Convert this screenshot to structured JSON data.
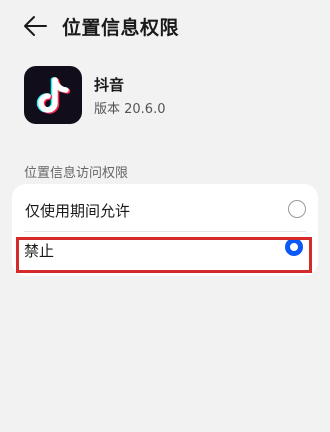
{
  "header": {
    "back_icon": "arrow-left-icon",
    "title": "位置信息权限"
  },
  "app": {
    "icon": "tiktok-logo-icon",
    "name": "抖音",
    "version": "版本 20.6.0"
  },
  "permission": {
    "section_label": "位置信息访问权限",
    "options": [
      {
        "label": "仅使用期间允许",
        "selected": false
      },
      {
        "label": "禁止",
        "selected": true
      }
    ]
  },
  "colors": {
    "accent": "#0a59f7",
    "highlight": "#d42a2a",
    "background": "#f2f2f2"
  }
}
